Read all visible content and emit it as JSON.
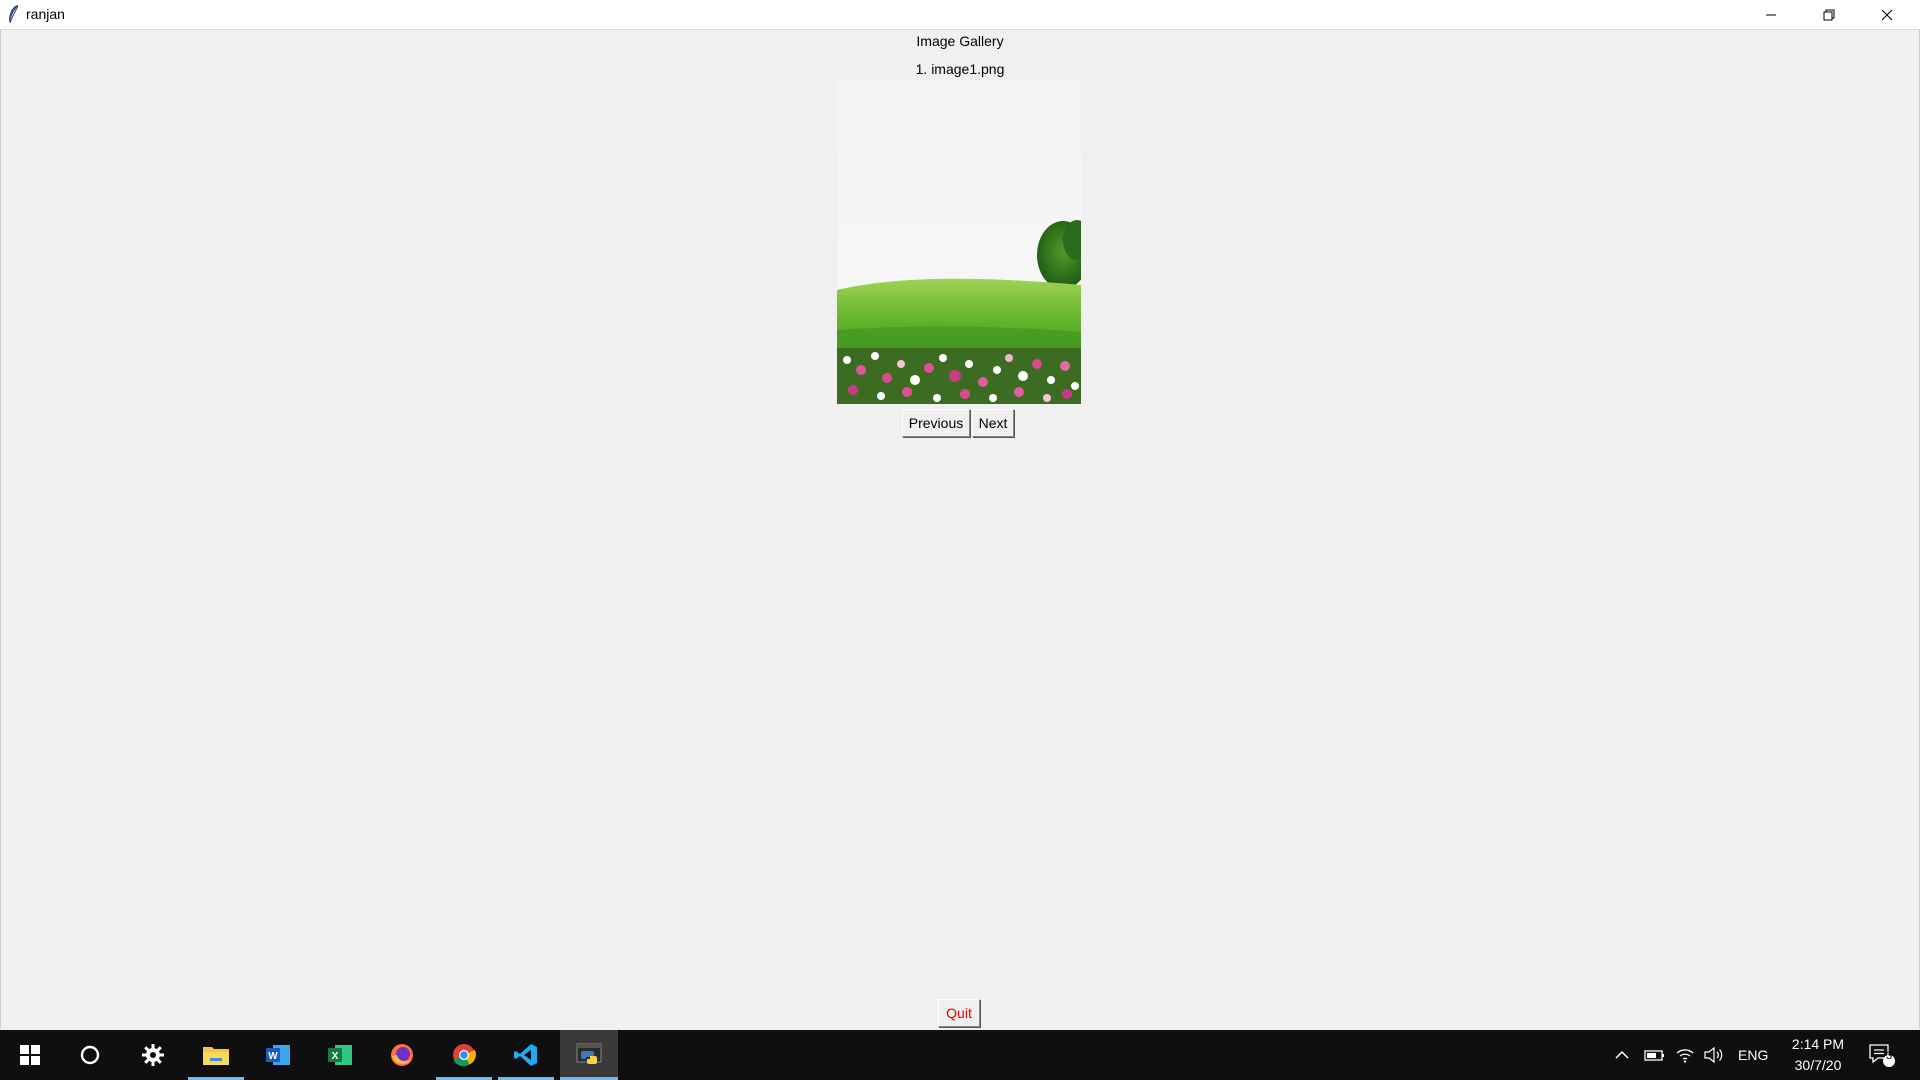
{
  "window": {
    "title": "ranjan"
  },
  "app": {
    "heading": "Image Gallery",
    "image_caption": "1. image1.png",
    "previous_label": "Previous",
    "next_label": "Next",
    "quit_label": "Quit"
  },
  "taskbar": {
    "apps": [
      "windows-start",
      "cortana-search",
      "settings",
      "file-explorer",
      "word",
      "excel",
      "firefox",
      "chrome",
      "vscode",
      "python"
    ],
    "language": "ENG",
    "time": "2:14 PM",
    "date": "30/7/20",
    "notification_count": "3"
  }
}
